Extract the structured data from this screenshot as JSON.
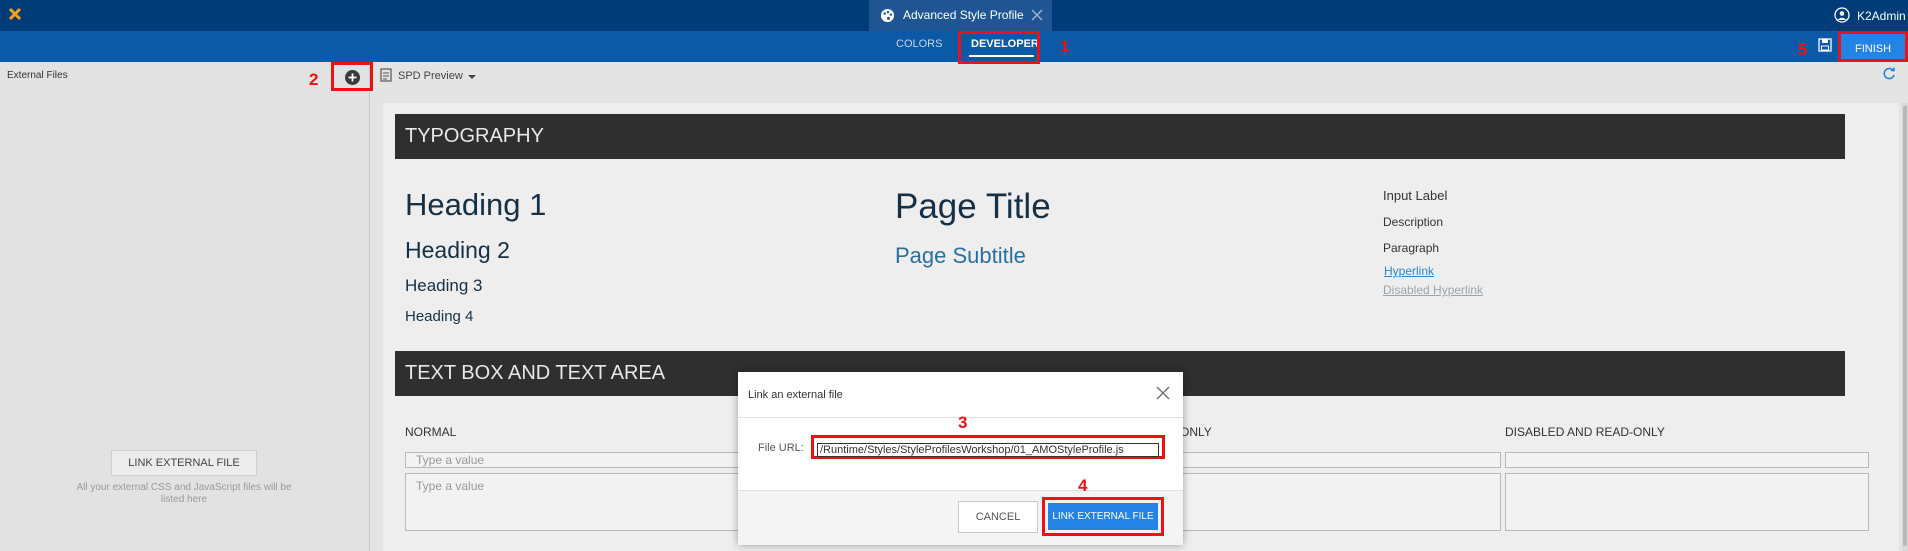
{
  "window": {
    "title": "Advanced Style Profile",
    "user": "K2Admin"
  },
  "tabs": [
    {
      "label": "COLORS"
    },
    {
      "label": "DEVELOPER"
    }
  ],
  "toolbar": {
    "finish_label": "FINISH",
    "preview_label": "SPD Preview"
  },
  "left_panel": {
    "title": "External Files",
    "link_button": "LINK EXTERNAL FILE",
    "help_text": "All your external CSS and JavaScript files will be listed here"
  },
  "typography": {
    "section_title": "TYPOGRAPHY",
    "heading1": "Heading 1",
    "heading2": "Heading 2",
    "heading3": "Heading 3",
    "heading4": "Heading 4",
    "page_title": "Page Title",
    "page_subtitle": "Page Subtitle",
    "input_label": "Input Label",
    "description": "Description",
    "paragraph": "Paragraph",
    "hyperlink": "Hyperlink",
    "disabled_hyperlink": "Disabled Hyperlink"
  },
  "textbox": {
    "section_title": "TEXT BOX AND TEXT AREA",
    "col_normal": "NORMAL",
    "col_readonly_partial": "ONLY",
    "col_disabled": "DISABLED AND READ-ONLY",
    "placeholder": "Type a value"
  },
  "modal": {
    "title": "Link an external file",
    "url_label": "File URL:",
    "url_value": "/Runtime/Styles/StyleProfilesWorkshop/01_AMOStyleProfile.js",
    "cancel_label": "CANCEL",
    "link_label": "LINK EXTERNAL FILE"
  },
  "annotations": {
    "m1": "1",
    "m2": "2",
    "m3": "3",
    "m4": "4",
    "m5": "5"
  },
  "colors": {
    "topbar": "#003d78",
    "tabbar": "#0c5aa7",
    "accent": "#2384e6",
    "highlight": "#ee1111"
  }
}
